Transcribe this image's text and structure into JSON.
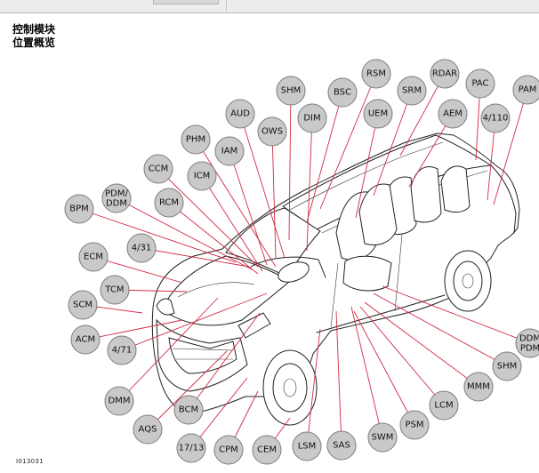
{
  "title_line1": "控制模块",
  "title_line2": "位置概览",
  "figure_id": "I013031",
  "modules": [
    {
      "label": "RSM"
    },
    {
      "label": "RDAR"
    },
    {
      "label": "SHM"
    },
    {
      "label": "BSC"
    },
    {
      "label": "SRM"
    },
    {
      "label": "PAC"
    },
    {
      "label": "PAM"
    },
    {
      "label": "AUD"
    },
    {
      "label": "DIM"
    },
    {
      "label": "UEM"
    },
    {
      "label": "AEM"
    },
    {
      "label": "4/110"
    },
    {
      "label": "OWS"
    },
    {
      "label": "PHM"
    },
    {
      "label": "IAM"
    },
    {
      "label": "CCM"
    },
    {
      "label": "ICM"
    },
    {
      "label": "PDM/\nDDM"
    },
    {
      "label": "RCM"
    },
    {
      "label": "BPM"
    },
    {
      "label": "4/31"
    },
    {
      "label": "ECM"
    },
    {
      "label": "TCM"
    },
    {
      "label": "SCM"
    },
    {
      "label": "ACM"
    },
    {
      "label": "4/71"
    },
    {
      "label": "DMM"
    },
    {
      "label": "BCM"
    },
    {
      "label": "AQS"
    },
    {
      "label": "17/13"
    },
    {
      "label": "CPM"
    },
    {
      "label": "CEM"
    },
    {
      "label": "LSM"
    },
    {
      "label": "SAS"
    },
    {
      "label": "SWM"
    },
    {
      "label": "PSM"
    },
    {
      "label": "LCM"
    },
    {
      "label": "MMM"
    },
    {
      "label": "SHM"
    },
    {
      "label": "DDM\nPDM"
    }
  ]
}
